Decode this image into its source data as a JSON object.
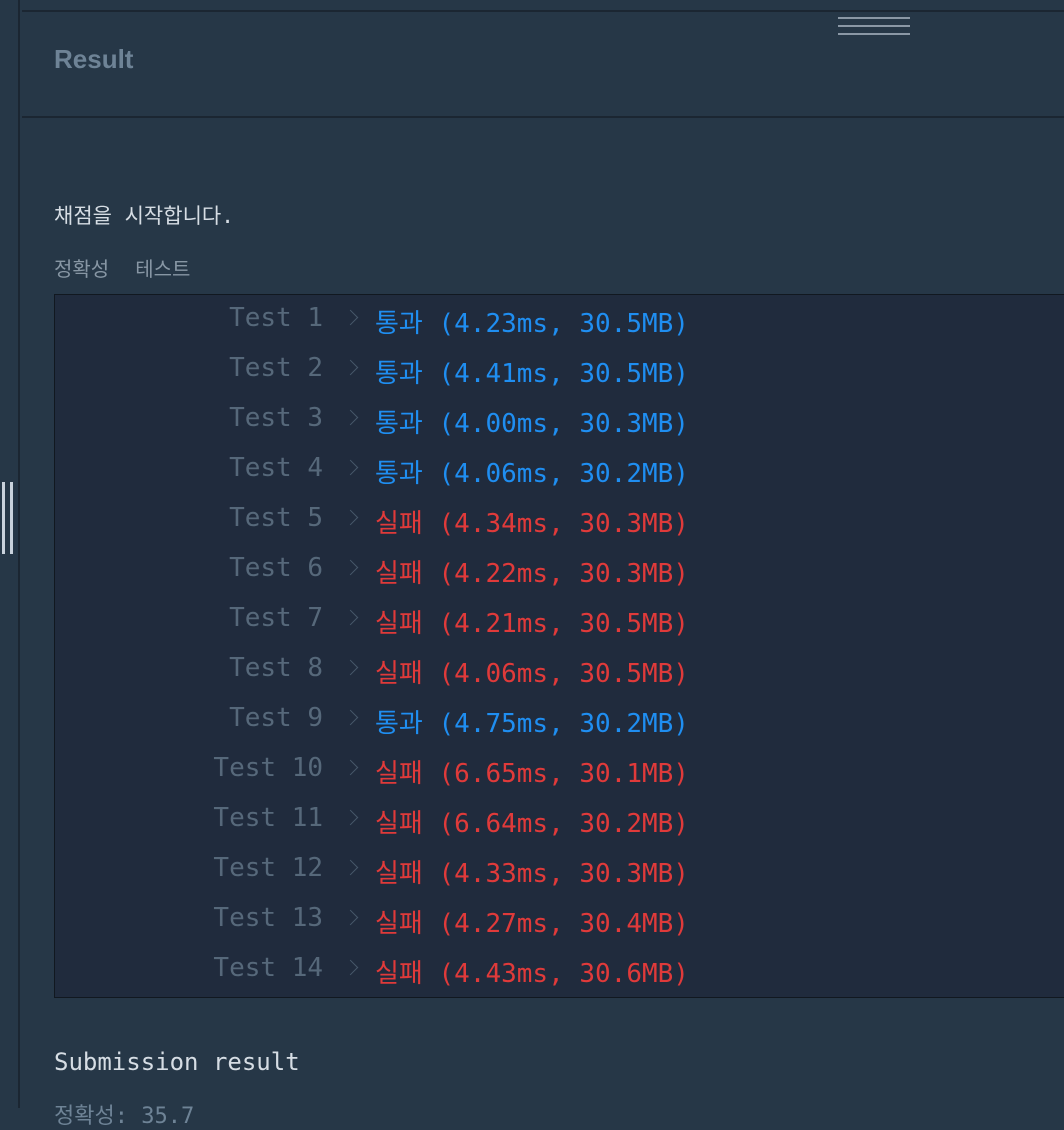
{
  "header": {
    "title": "Result"
  },
  "intro": "채점을 시작합니다.",
  "tabs": [
    "정확성",
    "테스트"
  ],
  "tests": [
    {
      "label": "Test 1",
      "status": "통과 (4.23ms, 30.5MB)",
      "result": "pass"
    },
    {
      "label": "Test 2",
      "status": "통과 (4.41ms, 30.5MB)",
      "result": "pass"
    },
    {
      "label": "Test 3",
      "status": "통과 (4.00ms, 30.3MB)",
      "result": "pass"
    },
    {
      "label": "Test 4",
      "status": "통과 (4.06ms, 30.2MB)",
      "result": "pass"
    },
    {
      "label": "Test 5",
      "status": "실패 (4.34ms, 30.3MB)",
      "result": "fail"
    },
    {
      "label": "Test 6",
      "status": "실패 (4.22ms, 30.3MB)",
      "result": "fail"
    },
    {
      "label": "Test 7",
      "status": "실패 (4.21ms, 30.5MB)",
      "result": "fail"
    },
    {
      "label": "Test 8",
      "status": "실패 (4.06ms, 30.5MB)",
      "result": "fail"
    },
    {
      "label": "Test 9",
      "status": "통과 (4.75ms, 30.2MB)",
      "result": "pass"
    },
    {
      "label": "Test 10",
      "status": "실패 (6.65ms, 30.1MB)",
      "result": "fail"
    },
    {
      "label": "Test 11",
      "status": "실패 (6.64ms, 30.2MB)",
      "result": "fail"
    },
    {
      "label": "Test 12",
      "status": "실패 (4.33ms, 30.3MB)",
      "result": "fail"
    },
    {
      "label": "Test 13",
      "status": "실패 (4.27ms, 30.4MB)",
      "result": "fail"
    },
    {
      "label": "Test 14",
      "status": "실패 (4.43ms, 30.6MB)",
      "result": "fail"
    }
  ],
  "submission_title": "Submission result",
  "colors": {
    "pass": "#1f8ef1",
    "fail": "#e03a3a",
    "background": "#263747",
    "result_box": "#202b3d"
  }
}
